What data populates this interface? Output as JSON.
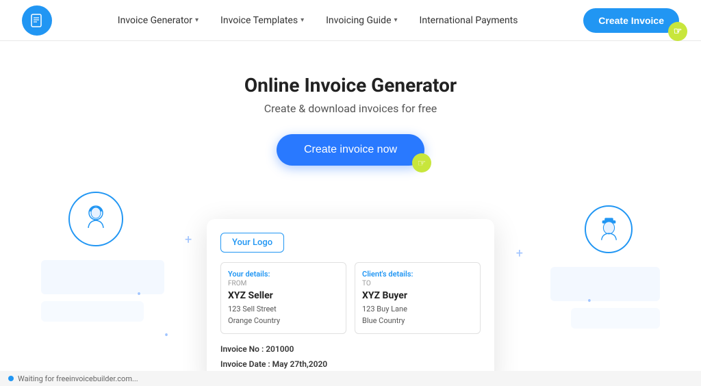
{
  "logo": {
    "icon": "📄",
    "alt": "Invoice Builder Logo"
  },
  "nav": {
    "items": [
      {
        "label": "Invoice Generator",
        "hasDropdown": true
      },
      {
        "label": "Invoice Templates",
        "hasDropdown": true
      },
      {
        "label": "Invoicing Guide",
        "hasDropdown": true
      },
      {
        "label": "International Payments",
        "hasDropdown": false
      }
    ],
    "cta_label": "Create Invoice"
  },
  "hero": {
    "title": "Online Invoice Generator",
    "subtitle": "Create & download invoices for free",
    "cta_label": "Create invoice now"
  },
  "invoice_preview": {
    "logo_placeholder": "Your Logo",
    "seller": {
      "label": "Your details:",
      "sublabel": "FROM",
      "name": "XYZ Seller",
      "address_line1": "123 Sell Street",
      "address_line2": "Orange Country"
    },
    "buyer": {
      "label": "Client's details:",
      "sublabel": "TO",
      "name": "XYZ Buyer",
      "address_line1": "123 Buy Lane",
      "address_line2": "Blue Country"
    },
    "invoice_no_label": "Invoice No :",
    "invoice_no_value": "201000",
    "invoice_date_label": "Invoice Date :",
    "invoice_date_value": "May 27th,2020"
  },
  "status_bar": {
    "text": "Waiting for freeinvoicebuilder.com..."
  },
  "colors": {
    "primary": "#2196F3",
    "cta_blue": "#2979FF",
    "accent_yellow": "#c8e63c",
    "light_blue_bg": "#e8f2ff"
  },
  "decorative": {
    "left_avatar": "👩",
    "right_avatar": "👮"
  }
}
